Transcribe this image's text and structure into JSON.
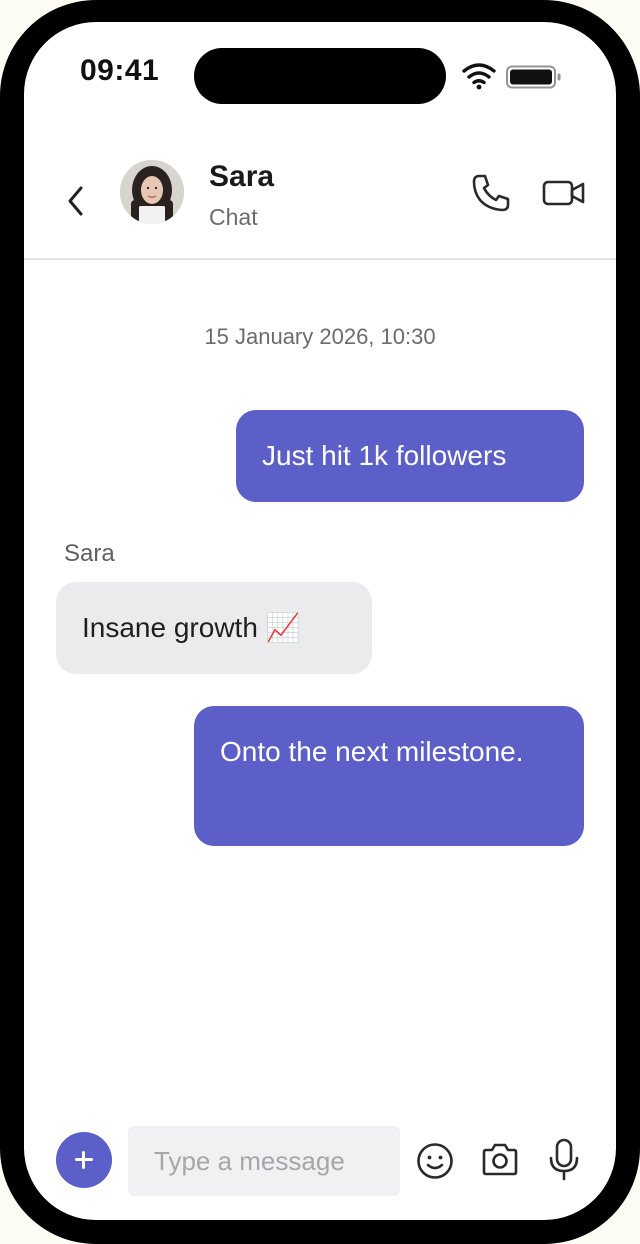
{
  "status_bar": {
    "time": "09:41"
  },
  "header": {
    "contact_name": "Sara",
    "contact_subtitle": "Chat",
    "icons": [
      "back-icon",
      "phone-icon",
      "video-camera-icon"
    ]
  },
  "conversation": {
    "date_divider": "15 January 2026, 10:30",
    "messages": [
      {
        "direction": "outgoing",
        "text": "Just hit 1k followers"
      },
      {
        "direction": "incoming",
        "sender": "Sara",
        "text": "Insane growth 📈"
      },
      {
        "direction": "outgoing",
        "text": "Onto the next milestone."
      }
    ]
  },
  "composer": {
    "placeholder": "Type a message",
    "icons": [
      "plus-icon",
      "emoji-icon",
      "camera-icon",
      "microphone-icon"
    ]
  },
  "colors": {
    "accent": "#5b5fc7",
    "incoming_bubble": "#ebebee",
    "input_background": "#f1f1f4"
  }
}
